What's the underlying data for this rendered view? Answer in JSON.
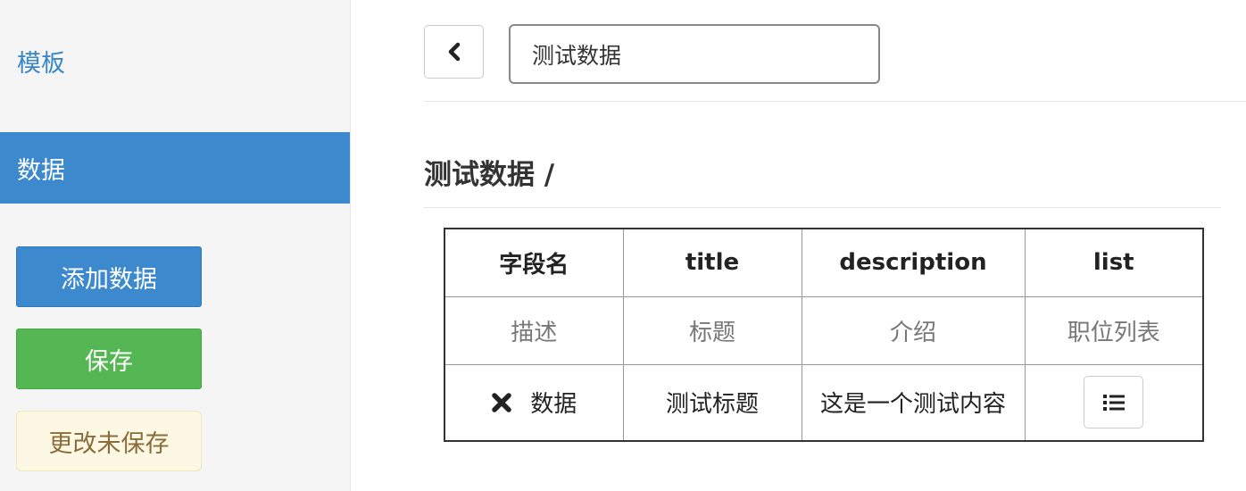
{
  "sidebar": {
    "nav_template": "模板",
    "nav_data": "数据",
    "add_button": "添加数据",
    "save_button": "保存",
    "unsaved_status": "更改未保存"
  },
  "toolbar": {
    "back_icon": "chevron-left-icon",
    "name_input_value": "测试数据"
  },
  "page": {
    "title": "测试数据 /"
  },
  "table": {
    "headers": [
      "字段名",
      "title",
      "description",
      "list"
    ],
    "descriptions": [
      "描述",
      "标题",
      "介绍",
      "职位列表"
    ],
    "row": {
      "delete_icon": "close-icon",
      "label": "数据",
      "title": "测试标题",
      "description": "这是一个测试内容",
      "list_icon": "list-icon"
    }
  },
  "colors": {
    "primary": "#3c8acd",
    "success": "#55b754",
    "warning_bg": "#fcf8e3",
    "warning_text": "#8a6d3b"
  }
}
